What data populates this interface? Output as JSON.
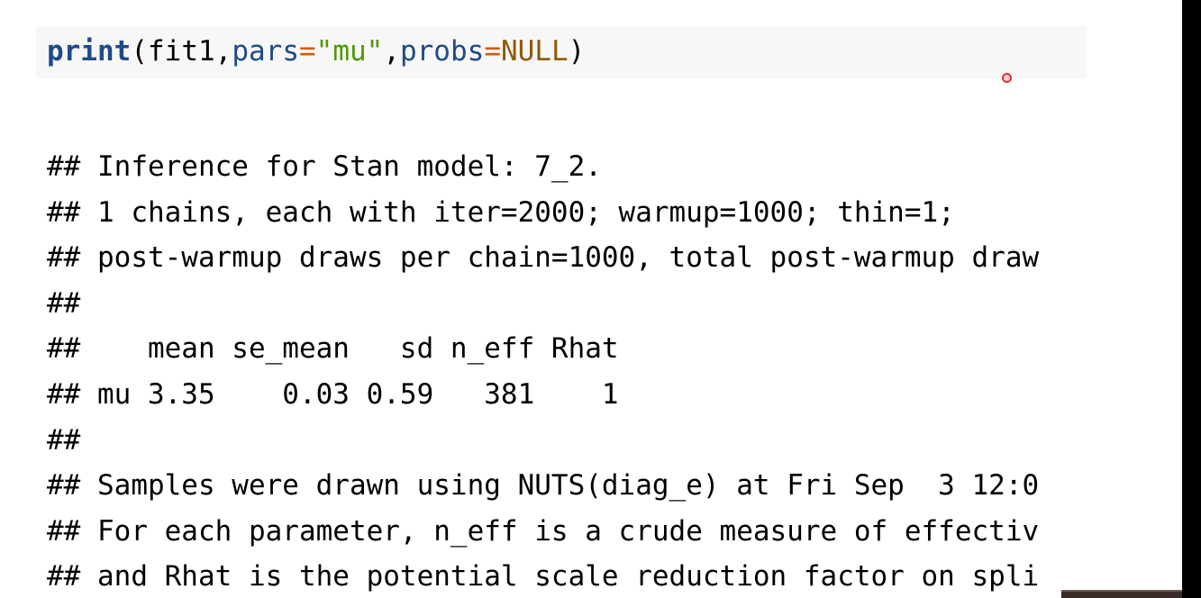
{
  "code": {
    "fn": "print",
    "open_paren": "(",
    "arg1": "fit1",
    "comma1": ",",
    "param1": "pars",
    "eq1": "=",
    "str1": "\"mu\"",
    "comma2": ",",
    "param2": "probs",
    "eq2": "=",
    "null": "NULL",
    "close_paren": ")"
  },
  "output_lines": [
    "## Inference for Stan model: 7_2.",
    "## 1 chains, each with iter=2000; warmup=1000; thin=1;",
    "## post-warmup draws per chain=1000, total post-warmup draw",
    "##",
    "##    mean se_mean   sd n_eff Rhat",
    "## mu 3.35    0.03 0.59   381    1",
    "##",
    "## Samples were drawn using NUTS(diag_e) at Fri Sep  3 12:0",
    "## For each parameter, n_eff is a crude measure of effectiv",
    "## and Rhat is the potential scale reduction factor on spli"
  ],
  "colors": {
    "code_background": "#f7f7f7",
    "function": "#204a87",
    "string": "#4e9a06",
    "null_keyword": "#8f5902",
    "operator": "#ce5c00",
    "side_bar": "#000000",
    "cursor": "#e0303a"
  }
}
